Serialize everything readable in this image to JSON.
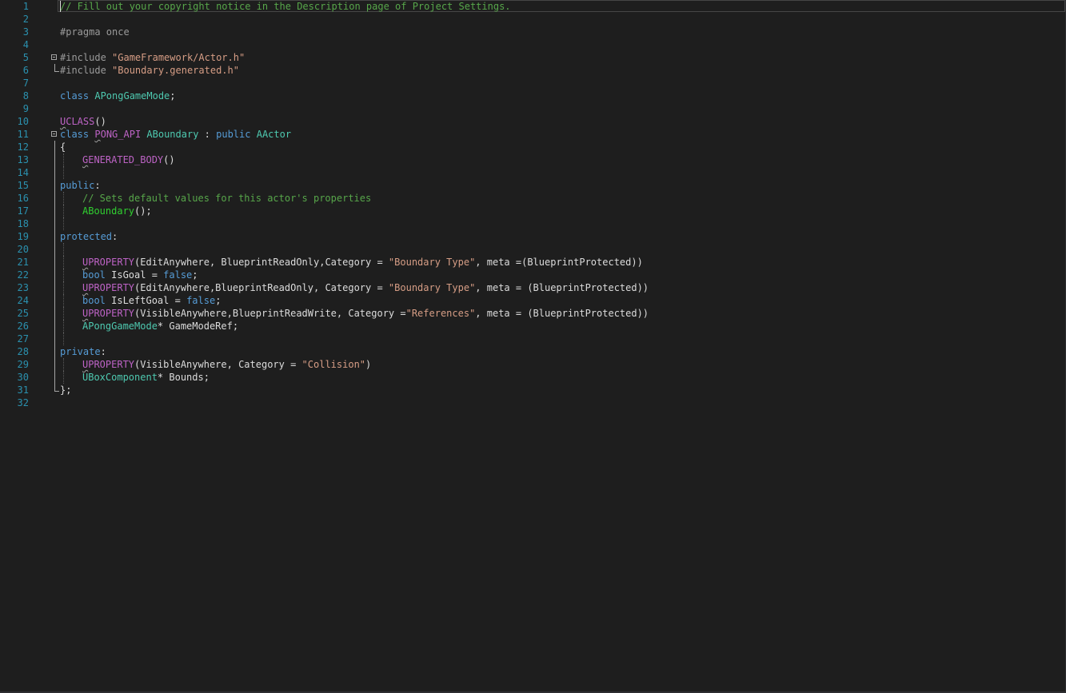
{
  "editor": {
    "lines": {
      "l1": "// Fill out your copyright notice in the Description page of Project Settings.",
      "l3": "#pragma once",
      "l5": [
        "#include ",
        "\"GameFramework/Actor.h\""
      ],
      "l6": [
        "#include ",
        "\"Boundary.generated.h\""
      ],
      "l8": [
        "class",
        " ",
        "APongGameMode",
        ";"
      ],
      "l10": [
        "U",
        "CLASS",
        "()"
      ],
      "l11": [
        "class",
        " ",
        "P",
        "ONG_API",
        " ",
        "ABoundary",
        " : ",
        "public",
        " ",
        "AActor"
      ],
      "l12": "{",
      "l13": [
        "G",
        "ENERATED_BODY",
        "()"
      ],
      "l15": [
        "public",
        ":"
      ],
      "l16": "// Sets default values for this actor's properties",
      "l17": [
        "ABoundary",
        "();"
      ],
      "l19": [
        "protected",
        ":"
      ],
      "l21": [
        "U",
        "PROPERTY",
        "(EditAnywhere, BlueprintReadOnly,Category = ",
        "\"Boundary Type\"",
        ", meta =(BlueprintProtected))"
      ],
      "l22": [
        "bool",
        " IsGoal = ",
        "false",
        ";"
      ],
      "l23": [
        "U",
        "PROPERTY",
        "(EditAnywhere,BlueprintReadOnly, Category = ",
        "\"Boundary Type\"",
        ", meta = (BlueprintProtected))"
      ],
      "l24": [
        "bool",
        " IsLeftGoal = ",
        "false",
        ";"
      ],
      "l25": [
        "U",
        "PROPERTY",
        "(VisibleAnywhere,BlueprintReadWrite, Category =",
        "\"References\"",
        ", meta = (BlueprintProtected))"
      ],
      "l26": [
        "APongGameMode",
        "* GameModeRef;"
      ],
      "l28": [
        "private",
        ":"
      ],
      "l29": [
        "U",
        "PROPERTY",
        "(VisibleAnywhere, Category = ",
        "\"Collision\"",
        ")"
      ],
      "l30": [
        "UBoxComponent",
        "* Bounds;"
      ],
      "l31": "};"
    }
  },
  "colors": {
    "background": "#1e1e1e",
    "line_number": "#2b91af",
    "keyword": "#569cd6",
    "string": "#d69d85",
    "comment": "#57a64a",
    "preprocessor": "#9b9b9b",
    "type": "#4ec9b0",
    "macro": "#bd63c5",
    "function": "#30d030",
    "text": "#dcdcdc"
  }
}
